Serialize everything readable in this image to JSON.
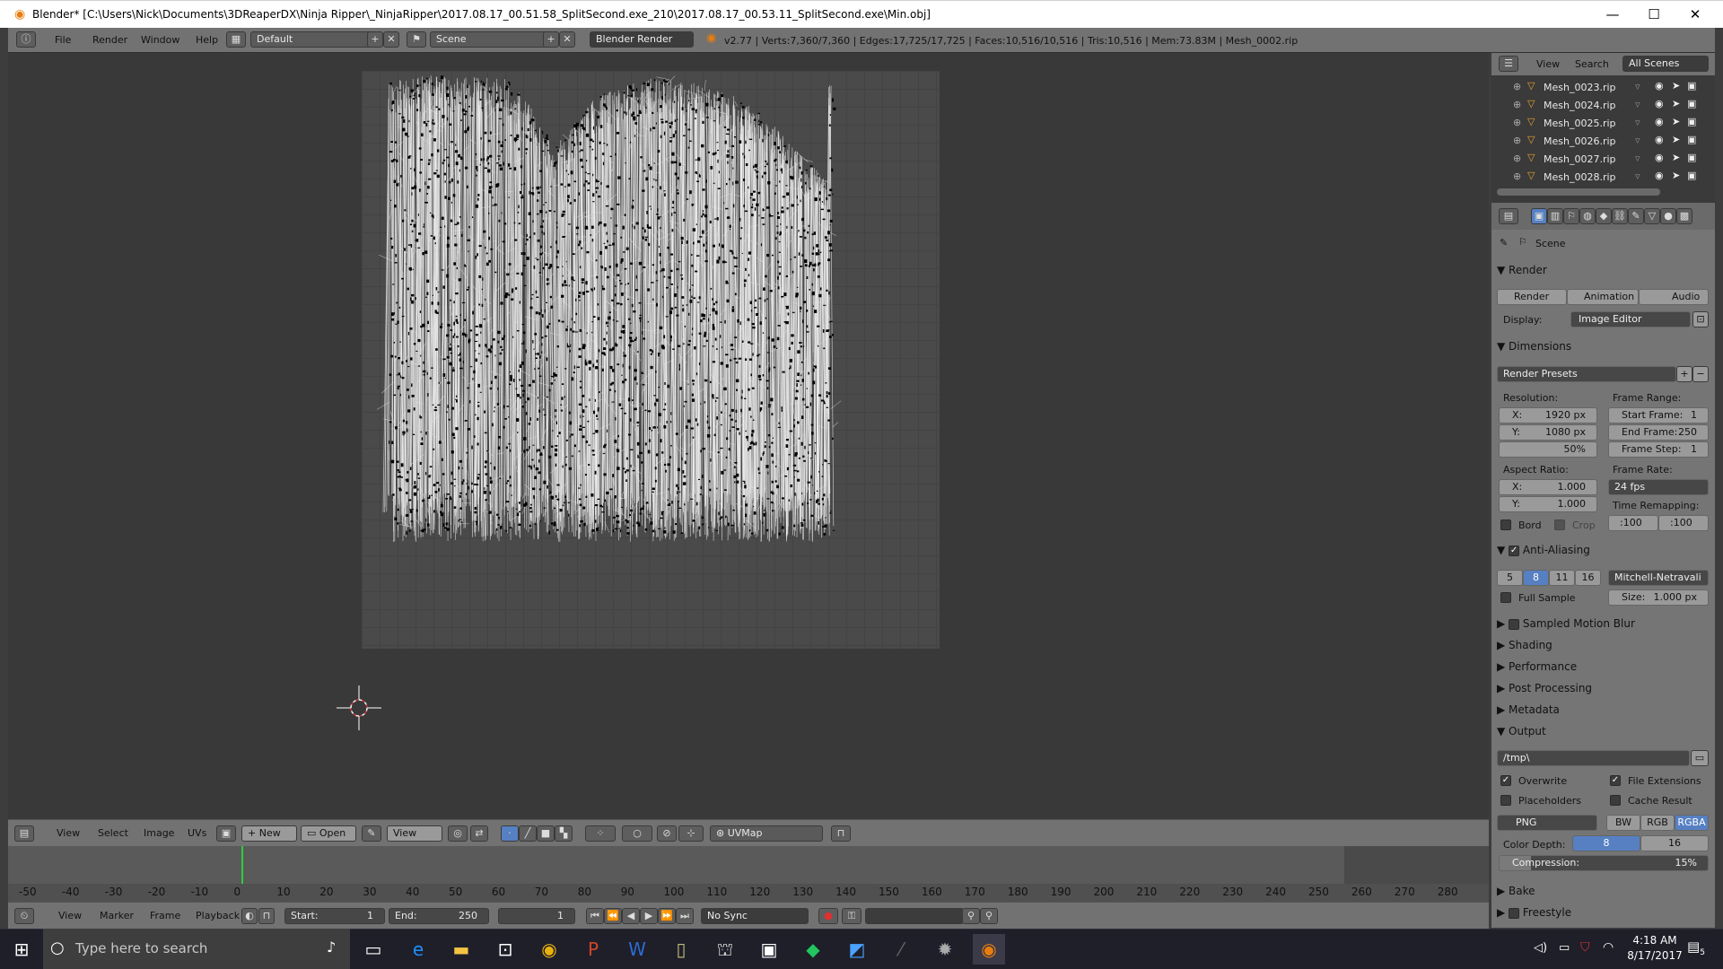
{
  "window": {
    "title": "Blender* [C:\\Users\\Nick\\Documents\\3DReaperDX\\Ninja Ripper\\_NinjaRipper\\2017.08.17_00.51.58_SplitSecond.exe_210\\2017.08.17_00.53.11_SplitSecond.exe\\Min.obj]",
    "minimize": "—",
    "maximize": "☐",
    "close": "✕"
  },
  "infobar": {
    "menus": [
      "File",
      "Render",
      "Window",
      "Help"
    ],
    "layout": "Default",
    "scene": "Scene",
    "engine": "Blender Render",
    "stats": "v2.77 | Verts:7,360/7,360 | Edges:17,725/17,725 | Faces:10,516/10,516 | Tris:10,516 | Mem:73.83M | Mesh_0002.rip"
  },
  "uv_header": {
    "menus": [
      "View",
      "Select",
      "Image",
      "UVs"
    ],
    "new_label": "New",
    "open_label": "Open",
    "view_label": "View",
    "uvmap": "UVMap"
  },
  "timeline": {
    "ticks": [
      "-50",
      "-40",
      "-30",
      "-20",
      "-10",
      "0",
      "10",
      "20",
      "30",
      "40",
      "50",
      "60",
      "70",
      "80",
      "90",
      "100",
      "110",
      "120",
      "130",
      "140",
      "150",
      "160",
      "170",
      "180",
      "190",
      "200",
      "210",
      "220",
      "230",
      "240",
      "250",
      "260",
      "270",
      "280"
    ],
    "menus": [
      "View",
      "Marker",
      "Frame",
      "Playback"
    ],
    "start_label": "Start:",
    "start_value": "1",
    "end_label": "End:",
    "end_value": "250",
    "current": "1",
    "sync": "No Sync",
    "current_frame_value": 0
  },
  "outliner": {
    "view": "View",
    "search": "Search",
    "scenes": "All Scenes",
    "items": [
      "Mesh_0023.rip",
      "Mesh_0024.rip",
      "Mesh_0025.rip",
      "Mesh_0026.rip",
      "Mesh_0027.rip",
      "Mesh_0028.rip"
    ]
  },
  "props": {
    "context": "Scene",
    "render_section": "Render",
    "render_btn": "Render",
    "animation_btn": "Animation",
    "audio_btn": "Audio",
    "display_label": "Display:",
    "display_value": "Image Editor",
    "dimensions_section": "Dimensions",
    "render_presets": "Render Presets",
    "resolution_label": "Resolution:",
    "res_x_label": "X:",
    "res_x": "1920 px",
    "res_y_label": "Y:",
    "res_y": "1080 px",
    "res_pct": "50%",
    "frame_range_label": "Frame Range:",
    "start_frame_label": "Start Frame:",
    "start_frame": "1",
    "end_frame_label": "End Frame:",
    "end_frame": "250",
    "frame_step_label": "Frame Step:",
    "frame_step": "1",
    "aspect_label": "Aspect Ratio:",
    "aspect_x_label": "X:",
    "aspect_x": "1.000",
    "aspect_y_label": "Y:",
    "aspect_y": "1.000",
    "frame_rate_label": "Frame Rate:",
    "frame_rate": "24 fps",
    "time_remap_label": "Time Remapping:",
    "remap_old": ":100",
    "remap_new": ":100",
    "bord": "Bord",
    "crop": "Crop",
    "aa_section": "Anti-Aliasing",
    "aa_samples": [
      "5",
      "8",
      "11",
      "16"
    ],
    "aa_filter": "Mitchell-Netravali",
    "full_sample": "Full Sample",
    "size_label": "Size:",
    "size_value": "1.000 px",
    "collapsed_sections": [
      "Sampled Motion Blur",
      "Shading",
      "Performance",
      "Post Processing",
      "Metadata"
    ],
    "output_section": "Output",
    "output_path": "/tmp\\",
    "overwrite": "Overwrite",
    "file_extensions": "File Extensions",
    "placeholders": "Placeholders",
    "cache_result": "Cache Result",
    "format": "PNG",
    "color_modes": [
      "BW",
      "RGB",
      "RGBA"
    ],
    "color_depth_label": "Color Depth:",
    "depths": [
      "8",
      "16"
    ],
    "compression_label": "Compression:",
    "compression": "15%",
    "compression_value": 15,
    "bake_section": "Bake",
    "freestyle_section": "Freestyle"
  },
  "taskbar": {
    "search_placeholder": "Type here to search",
    "time": "4:18 AM",
    "date": "8/17/2017",
    "notif_count": "5"
  },
  "colors": {
    "accent": "#5680c2",
    "blender_orange": "#e87d0d",
    "frame_line": "#2ecc40"
  }
}
